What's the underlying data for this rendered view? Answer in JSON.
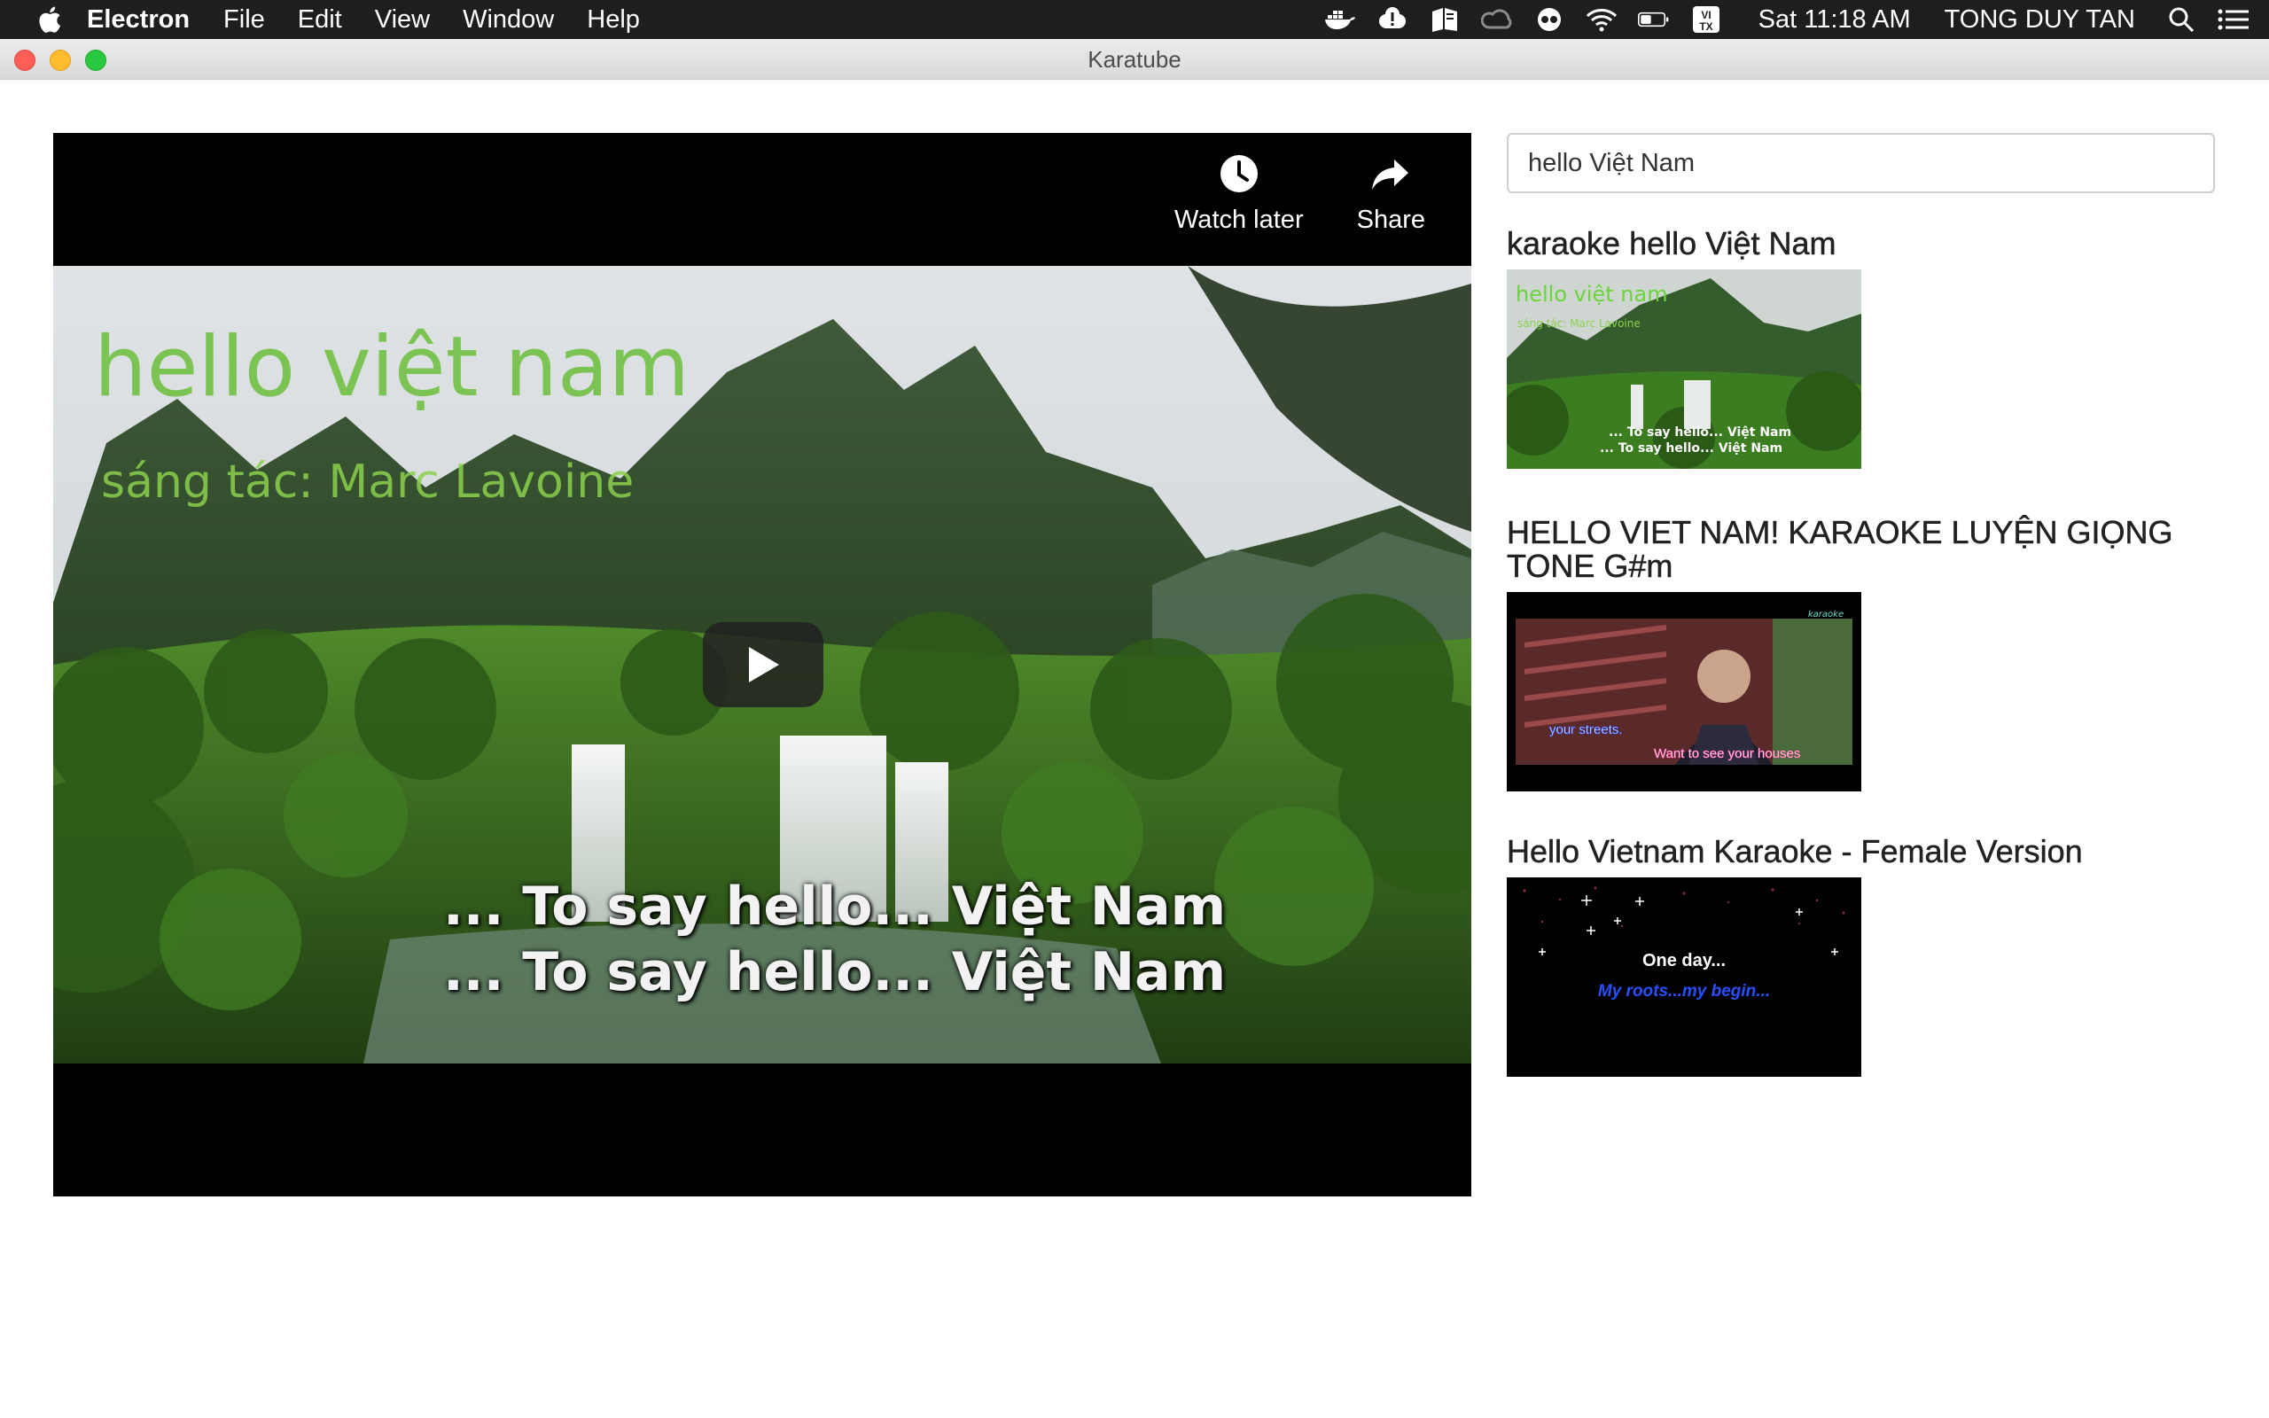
{
  "menubar": {
    "app_name": "Electron",
    "items": [
      "File",
      "Edit",
      "View",
      "Window",
      "Help"
    ],
    "clock": "Sat 11:18 AM",
    "user": "TONG DUY TAN",
    "input_source_badge": "VI TX"
  },
  "window": {
    "title": "Karatube"
  },
  "player": {
    "watch_later_label": "Watch later",
    "share_label": "Share",
    "overlay_title": "hello việt nam",
    "overlay_credit": "sáng tác:   Marc Lavoine",
    "lyric_line_1": "... To say hello... Việt Nam",
    "lyric_line_2": "... To say hello... Việt Nam"
  },
  "search": {
    "value": "hello Việt Nam"
  },
  "results": [
    {
      "title": "karaoke hello Việt Nam",
      "thumb_text_1": "hello việt nam",
      "thumb_text_2": "sáng tác:  Marc Lavoine",
      "thumb_text_3": "... To say hello... Việt Nam",
      "thumb_text_4": "... To say hello... Việt Nam"
    },
    {
      "title": "HELLO VIET NAM! KARAOKE LUYỆN GIỌNG TONE G#m",
      "thumb_text_1": "your streets.",
      "thumb_text_2": "Want to see your houses"
    },
    {
      "title": "Hello Vietnam Karaoke - Female Version",
      "thumb_text_1": "One day...",
      "thumb_text_2": "My roots...my begin..."
    }
  ],
  "colors": {
    "menubar_bg": "#1e1e20",
    "accent_green": "#6bbf3a",
    "karaoke_blue": "#2a4fff",
    "karaoke_pink": "#ff4fa3"
  }
}
